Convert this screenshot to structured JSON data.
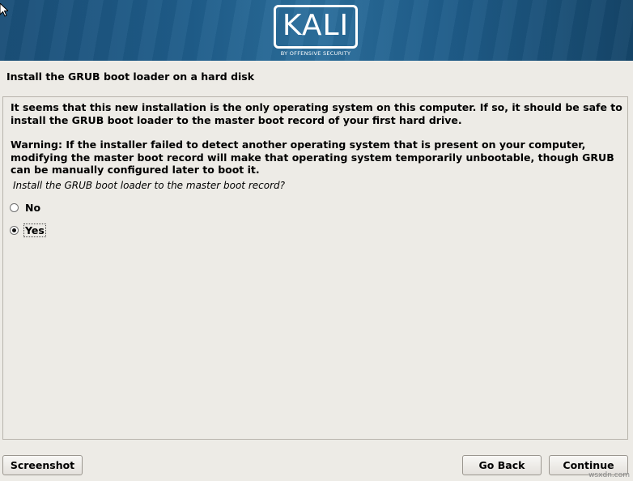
{
  "banner": {
    "logo_text": "KALI",
    "logo_subtext": "BY OFFENSIVE SECURITY"
  },
  "page_title": "Install the GRUB boot loader on a hard disk",
  "content": {
    "paragraph1": "It seems that this new installation is the only operating system on this computer. If so, it should be safe to install the GRUB boot loader to the master boot record of your first hard drive.",
    "paragraph2": "Warning: If the installer failed to detect another operating system that is present on your computer, modifying the master boot record will make that operating system temporarily unbootable, though GRUB can be manually configured later to boot it.",
    "question": "Install the GRUB boot loader to the master boot record?",
    "options": [
      {
        "label": "No",
        "selected": false
      },
      {
        "label": "Yes",
        "selected": true
      }
    ]
  },
  "buttons": {
    "screenshot": "Screenshot",
    "go_back": "Go Back",
    "continue": "Continue"
  },
  "watermark": "wsxdn.com",
  "colors": {
    "banner": "#1f5d8a",
    "background": "#edebe6"
  }
}
